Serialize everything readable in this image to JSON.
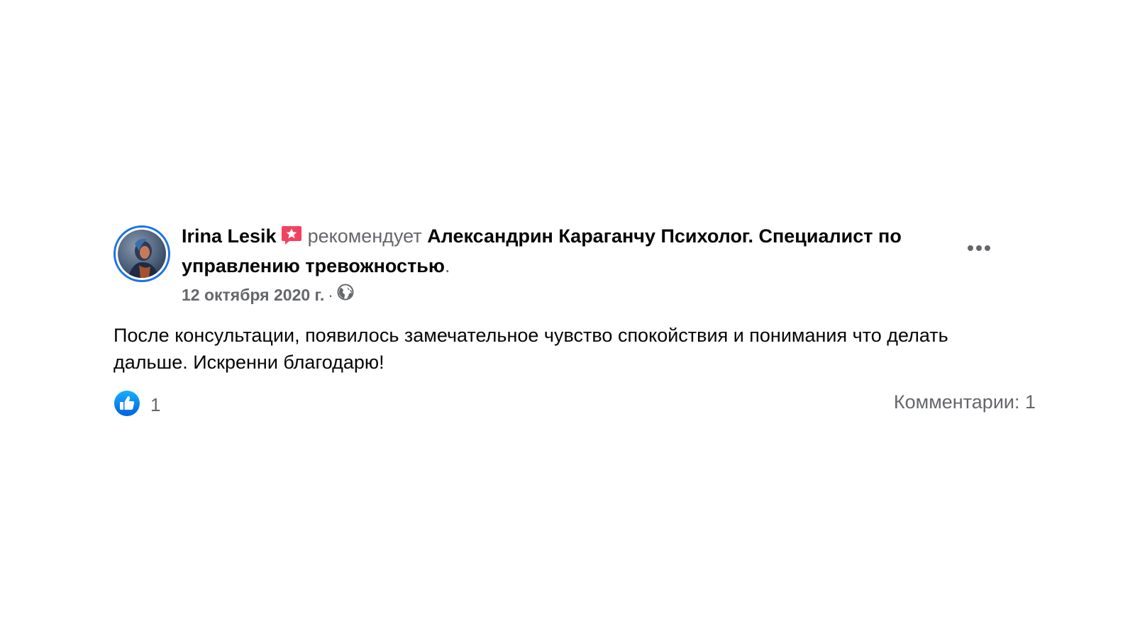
{
  "post": {
    "author": "Irina Lesik",
    "verb": "рекомендует",
    "page_name": "Александрин Караганчу Психолог. Специалист по управлению тревожностью",
    "period": ".",
    "date": "12 октября 2020 г.",
    "separator": "·",
    "audience_icon": "globe-icon",
    "recommend_icon": "recommend-star-icon",
    "body": "После консультации, появилось замечательное чувство спокойствия и понимания что делать дальше. Искренни благодарю!",
    "reactions": {
      "icon": "like-icon",
      "count": "1"
    },
    "comments_label": "Комментарии: 1"
  },
  "colors": {
    "accent": "#1b74e4",
    "recommend": "#f3425f",
    "secondary_text": "#65676b",
    "primary_text": "#050505"
  }
}
